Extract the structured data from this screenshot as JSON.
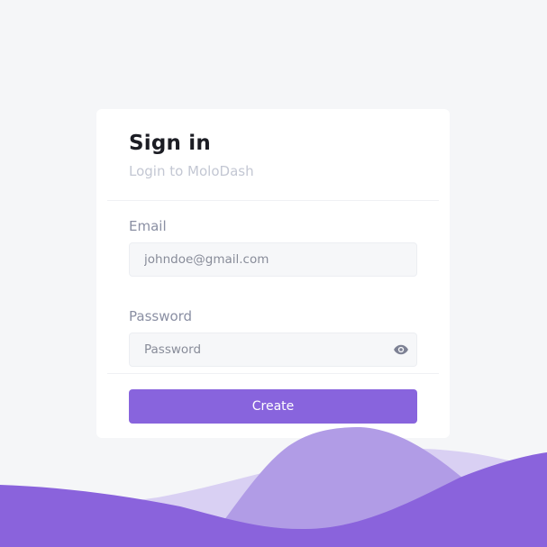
{
  "header": {
    "title": "Sign in",
    "subtitle": "Login to MoloDash"
  },
  "form": {
    "email": {
      "label": "Email",
      "placeholder": "johndoe@gmail.com",
      "value": ""
    },
    "password": {
      "label": "Password",
      "placeholder": "Password",
      "value": "",
      "toggle_icon": "eye-icon"
    },
    "submit_label": "Create"
  },
  "colors": {
    "page_background": "#f5f6f8",
    "card_background": "#ffffff",
    "accent": "#8864dd",
    "wave_light": "#d9d0f3",
    "wave_medium": "#b19ce6",
    "wave_dark": "#8a63dc",
    "title_text": "#1c1d24",
    "muted_text": "#c3c7d3",
    "label_text": "#8a8fa3"
  }
}
